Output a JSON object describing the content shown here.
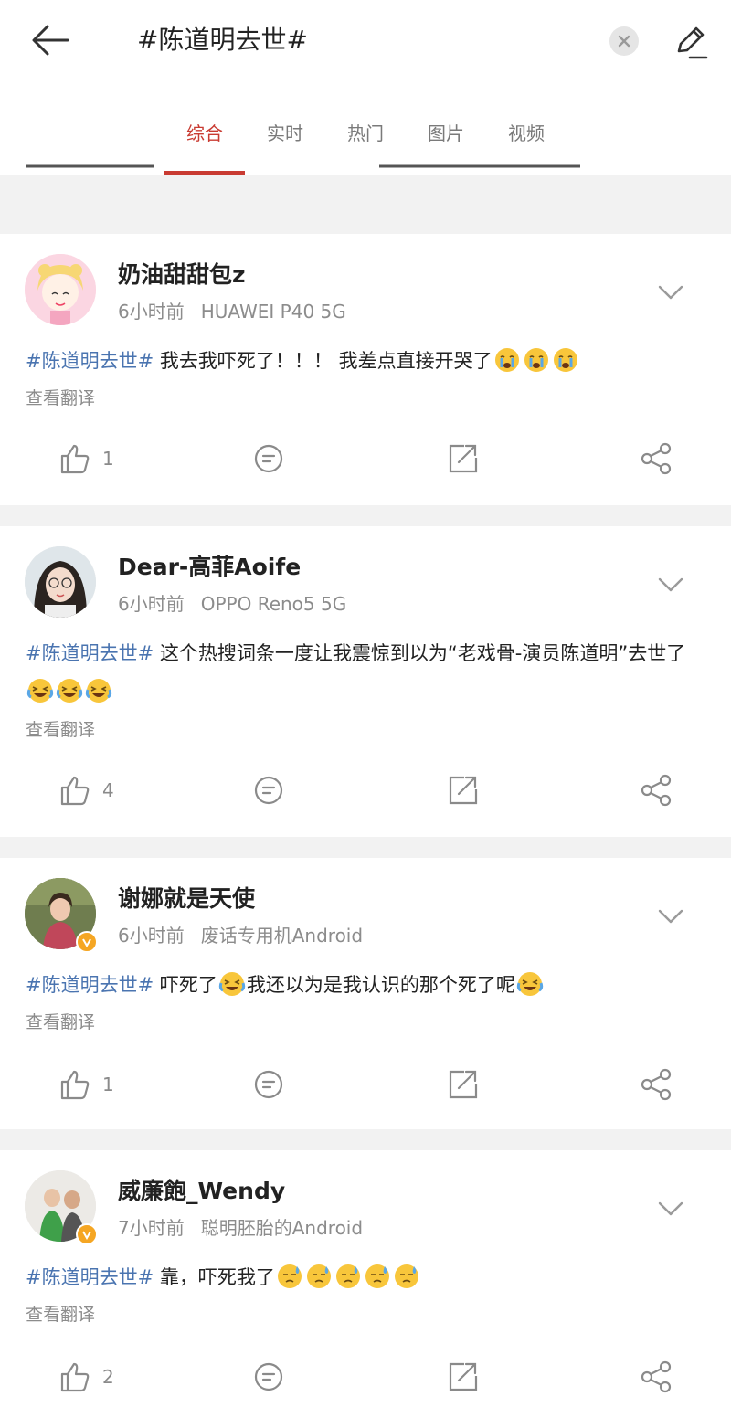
{
  "header": {
    "search_query": "#陈道明去世#",
    "tabs": [
      {
        "label": "综合"
      },
      {
        "label": "实时"
      },
      {
        "label": "热门"
      },
      {
        "label": "图片"
      },
      {
        "label": "视频"
      }
    ],
    "accent_color": "#c93b32",
    "hashtag_color": "#4a74b0"
  },
  "posts": [
    {
      "username": "奶油甜甜包z",
      "time": "6小时前",
      "device": "HUAWEI P40 5G",
      "hashtag": "#陈道明去世#",
      "text": "我去我吓死了！！！ 我差点直接开哭了",
      "emoji": "crying-face",
      "translate": "查看翻译",
      "likes": "1",
      "verified": false
    },
    {
      "username": "Dear-高菲Aoife",
      "time": "6小时前",
      "device": "OPPO Reno5 5G",
      "hashtag": "#陈道明去世#",
      "text": "这个热搜词条一度让我震惊到以为“老戏骨-演员陈道明”去世了",
      "emoji": "laughing-tears-face",
      "translate": "查看翻译",
      "likes": "4",
      "verified": false
    },
    {
      "username": "谢娜就是天使",
      "time": "6小时前",
      "device": "废话专用机Android",
      "hashtag": "#陈道明去世#",
      "text_1": "吓死了",
      "text_2": "我还以为是我认识的那个死了呢",
      "emoji": "laughing-tears-face",
      "translate": "查看翻译",
      "likes": "1",
      "verified": true
    },
    {
      "username": "威廉飽_Wendy",
      "time": "7小时前",
      "device": "聪明胚胎的Android",
      "hashtag": "#陈道明去世#",
      "text": "靠，吓死我了",
      "emoji": "sweat-face",
      "translate": "查看翻译",
      "likes": "2",
      "verified": true
    }
  ]
}
